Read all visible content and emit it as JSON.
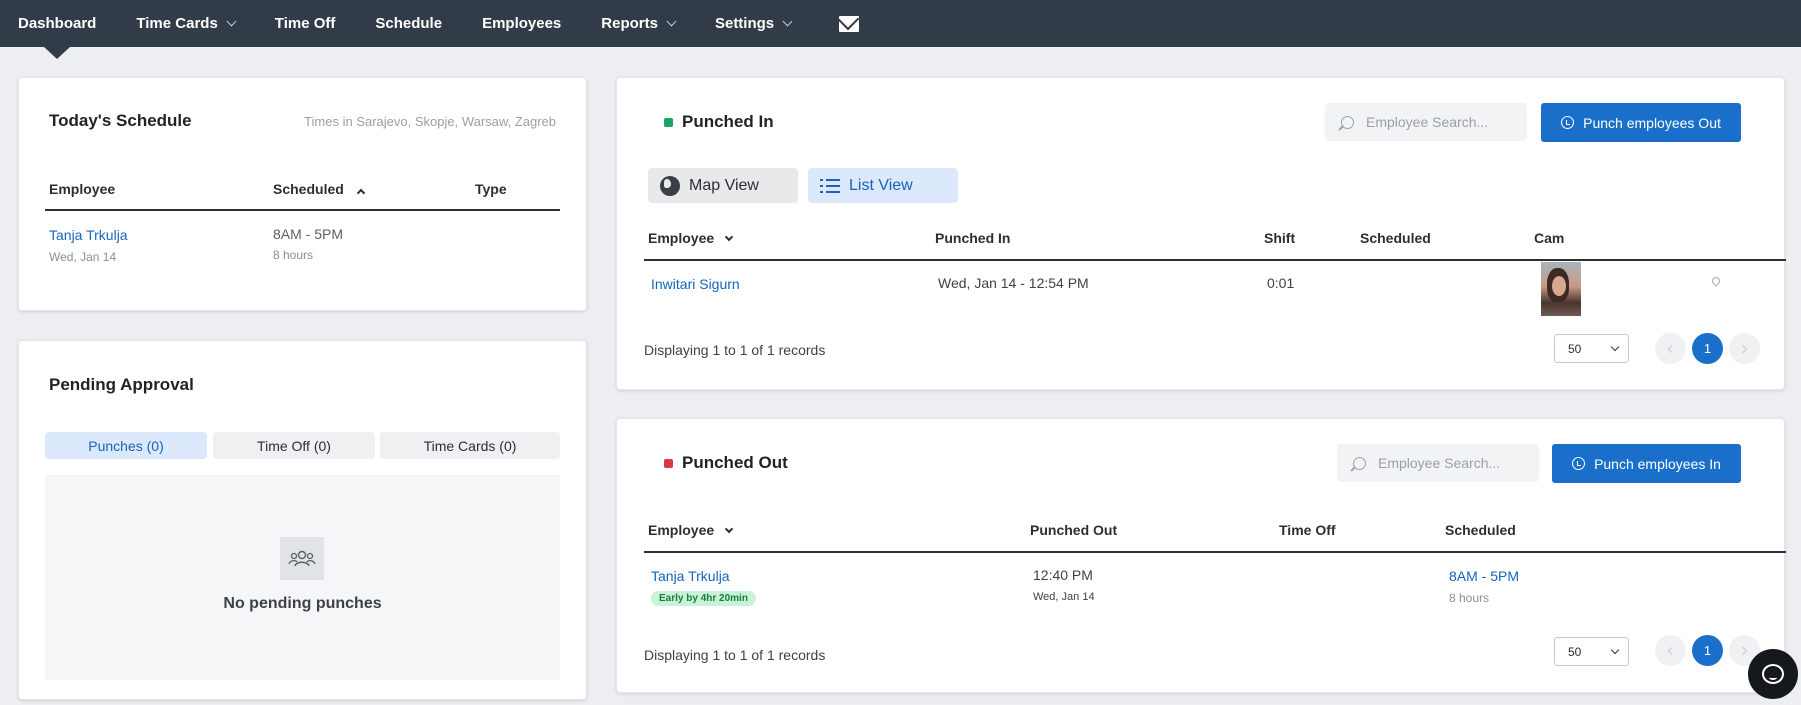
{
  "nav": {
    "items": [
      {
        "label": "Dashboard",
        "has_dropdown": false,
        "active": true
      },
      {
        "label": "Time Cards",
        "has_dropdown": true
      },
      {
        "label": "Time Off",
        "has_dropdown": false
      },
      {
        "label": "Schedule",
        "has_dropdown": false
      },
      {
        "label": "Employees",
        "has_dropdown": false
      },
      {
        "label": "Reports",
        "has_dropdown": true
      },
      {
        "label": "Settings",
        "has_dropdown": true
      }
    ],
    "mail_icon": "envelope-icon"
  },
  "schedule": {
    "title": "Today's Schedule",
    "timezone": "Times in Sarajevo, Skopje, Warsaw, Zagreb",
    "columns": [
      "Employee",
      "Scheduled",
      "Type"
    ],
    "rows": [
      {
        "name": "Tanja Trkulja",
        "date": "Wed, Jan 14",
        "time": "8AM - 5PM",
        "hours": "8 hours",
        "type": ""
      }
    ]
  },
  "pending": {
    "title": "Pending Approval",
    "tabs": [
      "Punches (0)",
      "Time Off (0)",
      "Time Cards (0)"
    ],
    "active_tab": 0,
    "empty_text": "No pending punches",
    "empty_icon": "people-icon"
  },
  "punched_in": {
    "title": "Punched In",
    "status_color": "#1aa36a",
    "search_placeholder": "Employee Search...",
    "action_label": "Punch employees Out",
    "views": [
      "Map View",
      "List View"
    ],
    "active_view": "List View",
    "columns": [
      "Employee",
      "Punched In",
      "Shift",
      "Scheduled",
      "Cam"
    ],
    "rows": [
      {
        "name": "Inwitari Sigurn",
        "punched_in": "Wed, Jan 14 - 12:54 PM",
        "shift": "0:01",
        "scheduled": ""
      }
    ],
    "records_text": "Displaying 1 to 1 of 1 records",
    "page_size": "50",
    "page": "1"
  },
  "punched_out": {
    "title": "Punched Out",
    "status_color": "#d93846",
    "search_placeholder": "Employee Search...",
    "action_label": "Punch employees In",
    "columns": [
      "Employee",
      "Punched Out",
      "Time Off",
      "Scheduled"
    ],
    "rows": [
      {
        "name": "Tanja Trkulja",
        "badge": "Early by 4hr 20min",
        "time": "12:40 PM",
        "date": "Wed, Jan 14",
        "time_off": "",
        "scheduled": "8AM - 5PM",
        "scheduled_hours": "8 hours"
      }
    ],
    "records_text": "Displaying 1 to 1 of 1 records",
    "page_size": "50",
    "page": "1"
  }
}
